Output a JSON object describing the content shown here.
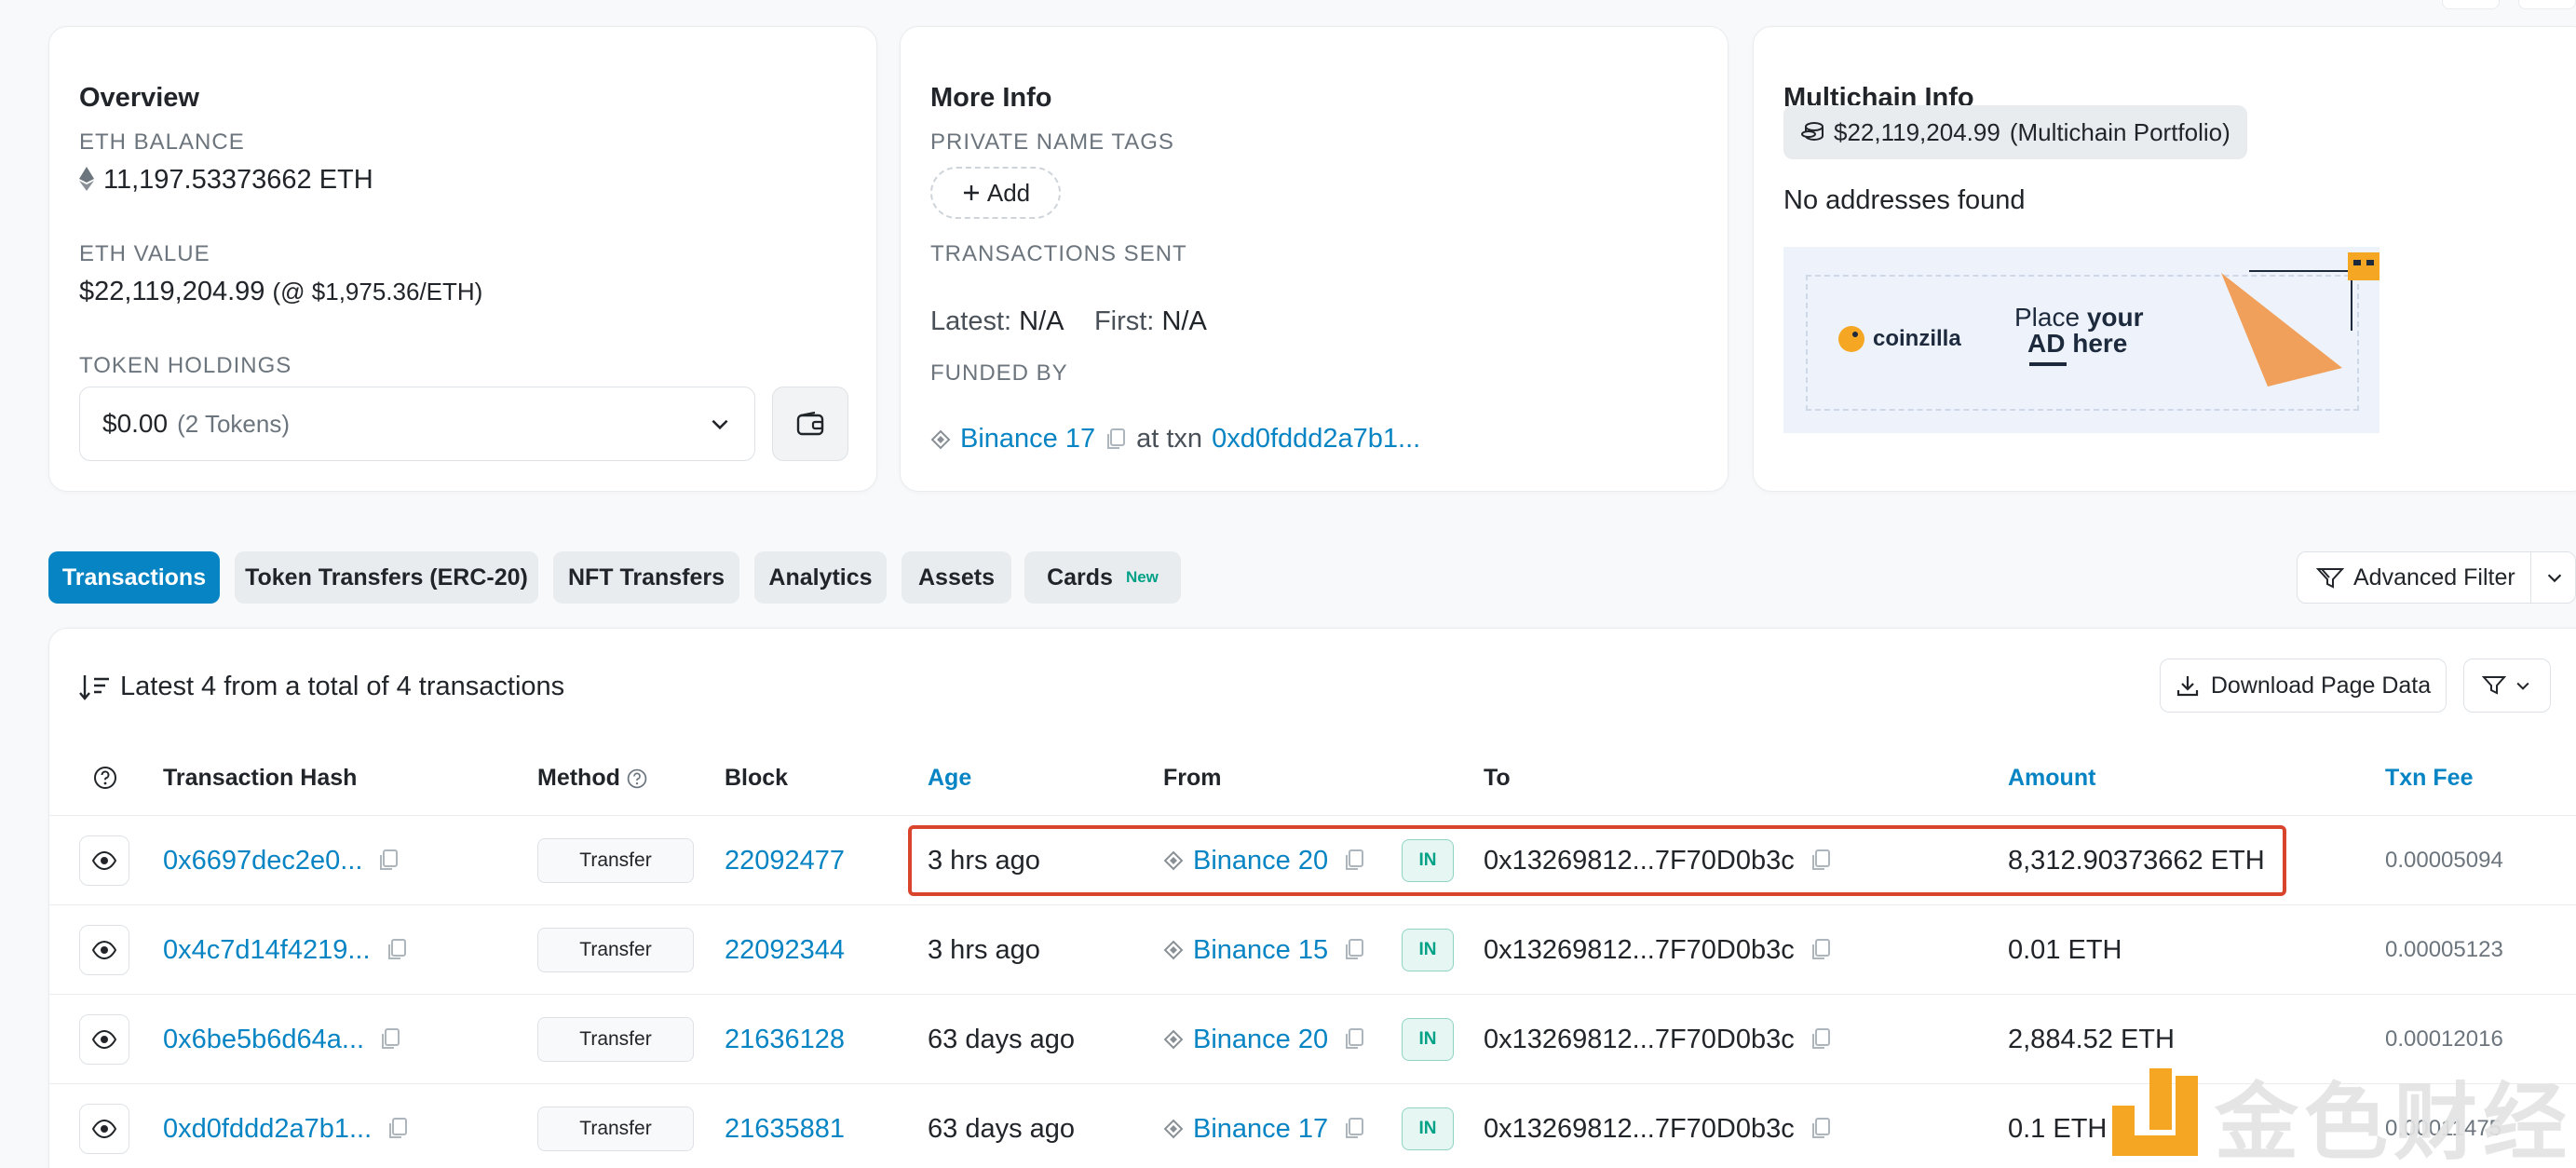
{
  "overview": {
    "title": "Overview",
    "eth_balance_label": "ETH BALANCE",
    "eth_balance": "11,197.53373662 ETH",
    "eth_value_label": "ETH VALUE",
    "eth_value": "$22,119,204.99",
    "eth_price": "(@ $1,975.36/ETH)",
    "token_holdings_label": "TOKEN HOLDINGS",
    "token_value": "$0.00",
    "token_count": "(2 Tokens)"
  },
  "more_info": {
    "title": "More Info",
    "private_tags_label": "PRIVATE NAME TAGS",
    "add_label": "Add",
    "tx_sent_label": "TRANSACTIONS SENT",
    "latest_key": "Latest:",
    "latest_val": "N/A",
    "first_key": "First:",
    "first_val": "N/A",
    "funded_by_label": "FUNDED BY",
    "funded_by": "Binance 17",
    "at_txn": "at txn",
    "funded_txn": "0xd0fddd2a7b1..."
  },
  "multichain": {
    "title": "Multichain Info",
    "portfolio": "$22,119,204.99",
    "portfolio_suffix": "(Multichain Portfolio)",
    "no_addresses": "No addresses found",
    "ad_brand": "coinzilla",
    "ad_line1_a": "Place",
    "ad_line1_b": "your",
    "ad_line2": "AD here"
  },
  "tabs": [
    {
      "label": "Transactions"
    },
    {
      "label": "Token Transfers (ERC-20)"
    },
    {
      "label": "NFT Transfers"
    },
    {
      "label": "Analytics"
    },
    {
      "label": "Assets"
    },
    {
      "label": "Cards",
      "badge": "New"
    }
  ],
  "advanced_filter": "Advanced Filter",
  "table": {
    "summary": "Latest 4 from a total of 4 transactions",
    "download": "Download Page Data",
    "headers": {
      "hash": "Transaction Hash",
      "method": "Method",
      "block": "Block",
      "age": "Age",
      "from": "From",
      "to": "To",
      "amount": "Amount",
      "fee": "Txn Fee"
    },
    "rows": [
      {
        "hash": "0x6697dec2e0...",
        "method": "Transfer",
        "block": "22092477",
        "age": "3 hrs ago",
        "from": "Binance 20",
        "dir": "IN",
        "to": "0x13269812...7F70D0b3c",
        "amount": "8,312.90373662 ETH",
        "fee": "0.00005094"
      },
      {
        "hash": "0x4c7d14f4219...",
        "method": "Transfer",
        "block": "22092344",
        "age": "3 hrs ago",
        "from": "Binance 15",
        "dir": "IN",
        "to": "0x13269812...7F70D0b3c",
        "amount": "0.01 ETH",
        "fee": "0.00005123"
      },
      {
        "hash": "0x6be5b6d64a...",
        "method": "Transfer",
        "block": "21636128",
        "age": "63 days ago",
        "from": "Binance 20",
        "dir": "IN",
        "to": "0x13269812...7F70D0b3c",
        "amount": "2,884.52 ETH",
        "fee": "0.00012016"
      },
      {
        "hash": "0xd0fddd2a7b1...",
        "method": "Transfer",
        "block": "21635881",
        "age": "63 days ago",
        "from": "Binance 17",
        "dir": "IN",
        "to": "0x13269812...7F70D0b3c",
        "amount": "0.1 ETH",
        "fee": "0.00011475"
      }
    ]
  },
  "watermark": "金色财经",
  "colors": {
    "accent": "#0784c3",
    "highlight": "#d9442c",
    "in_badge": "#00a186"
  }
}
